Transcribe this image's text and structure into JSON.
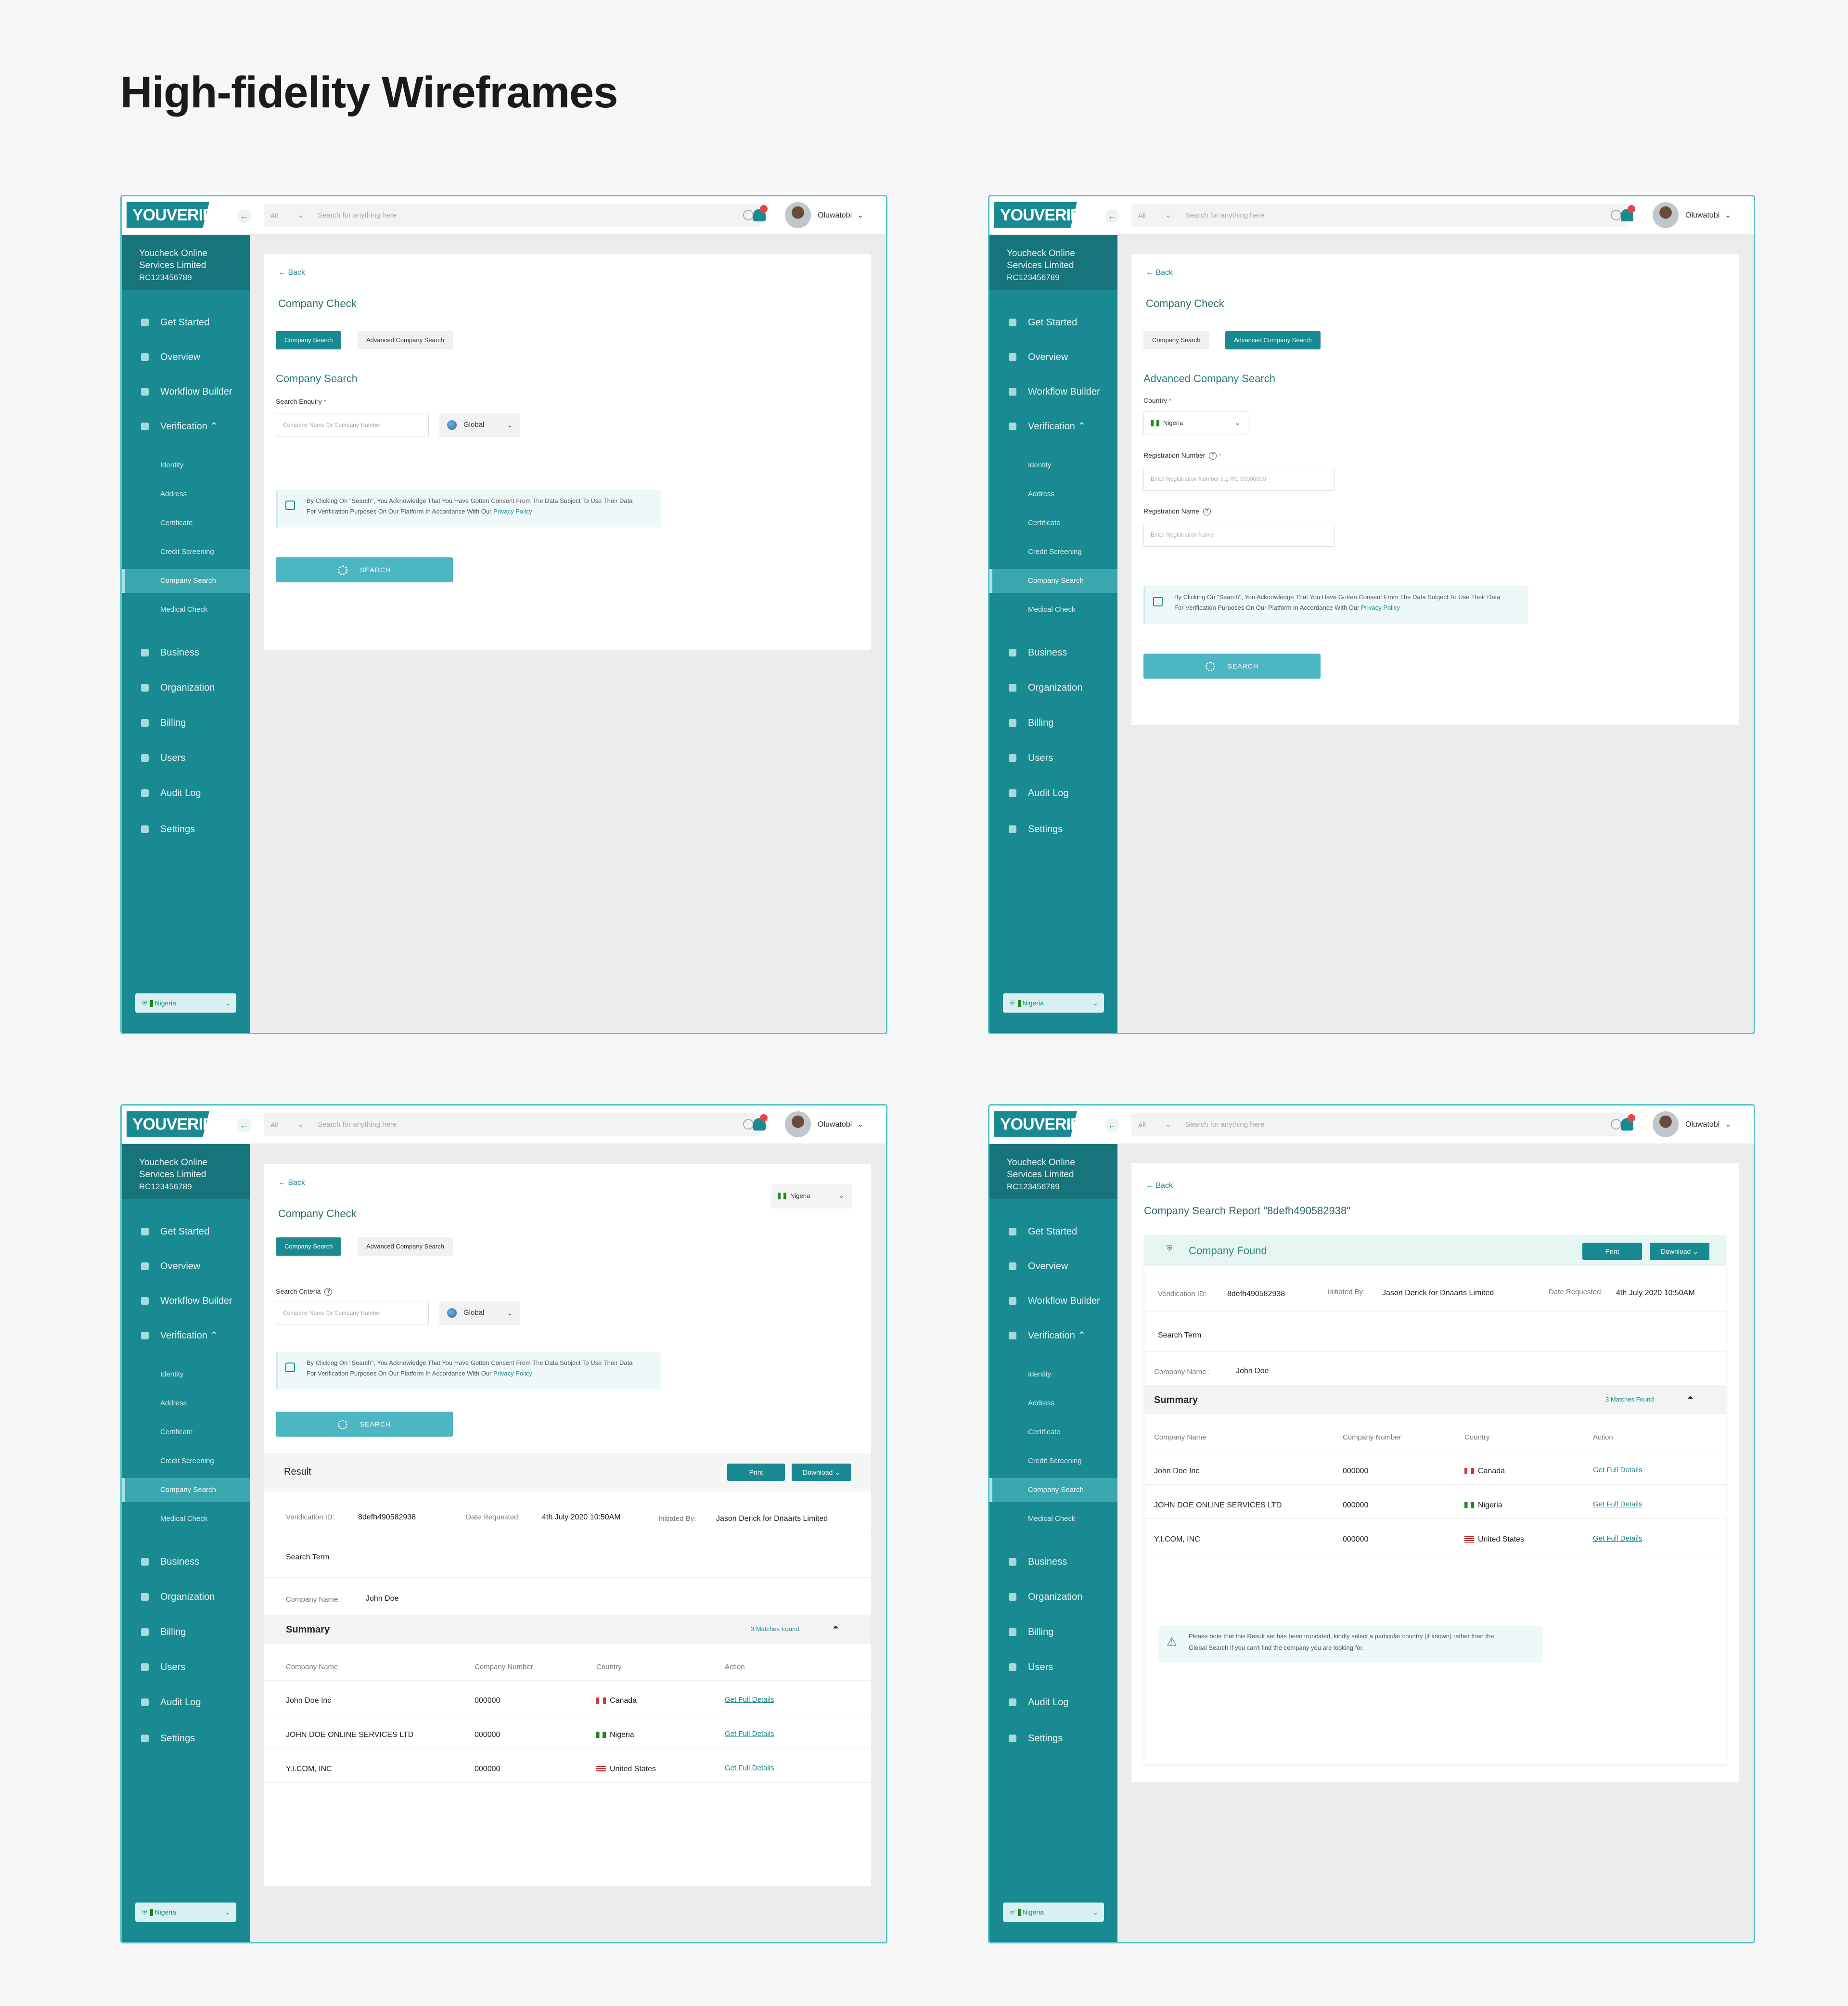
{
  "page_title": "High-fidelity Wireframes",
  "app": {
    "logo": "YOUVERIFY",
    "search_scope": "All",
    "search_placeholder": "Search for anything here",
    "user_name": "Oluwatobi",
    "org_name_line1": "Youcheck Online",
    "org_name_line2": "Services Limited",
    "org_rc": "RC123456789",
    "country_selector": "Nigeria"
  },
  "nav": {
    "get_started": "Get Started",
    "overview": "Overview",
    "workflow_builder": "Workflow Builder",
    "verification": "Verification",
    "identity": "Identity",
    "address": "Address",
    "certificate": "Certificate",
    "credit_screening": "Credit Screening",
    "company_search": "Company Search",
    "medical_check": "Medical Check",
    "business": "Business",
    "organization": "Organization",
    "billing": "Billing",
    "users": "Users",
    "audit_log": "Audit Log",
    "settings": "Settings"
  },
  "common": {
    "back": "Back",
    "company_check": "Company Check",
    "tab_company_search": "Company Search",
    "tab_advanced_company_search": "Advanced Company Search",
    "company_name_placeholder": "Company Name Or Company Number",
    "global": "Global",
    "consent_line1": "By Clicking On \"Search\", You Acknowledge That You Have Gotten Consent From The Data Subject To Use Their Data",
    "consent_line2": "For Verification Purposes On Our Platform In Accordance With Our",
    "privacy_policy": "Privacy Policy",
    "search_button": "SEARCH",
    "nigeria": "Nigeria"
  },
  "frame1": {
    "section_title": "Company Search",
    "field_label": "Search Enquiry"
  },
  "frame2": {
    "section_title": "Advanced Company Search",
    "country_label": "Country",
    "reg_number_label": "Registration Number",
    "reg_number_placeholder": "Enter Registration Number e.g RC 00000000",
    "reg_name_label": "Registration Name",
    "reg_name_placeholder": "Enter Registration Name"
  },
  "result": {
    "result_label": "Result",
    "print": "Print",
    "download": "Download",
    "verification_id_label": "Veridication ID:",
    "verification_id": "8defh490582938",
    "date_label": "Date Requested:",
    "date_value": "4th July 2020 10:50AM",
    "initiated_label": "Initiated By:",
    "initiated_name": "Jason Derick",
    "initiated_for": "for",
    "initiated_company": "Dnaarts Limited",
    "search_term": "Search Term",
    "company_name_label": "Company Name :",
    "company_name_value": "John Doe",
    "summary": "Summary",
    "matches": "3 Matches Found",
    "columns": [
      "Company Name",
      "Company Number",
      "Country",
      "Action"
    ],
    "rows": [
      {
        "name": "John Doe Inc",
        "number": "000000",
        "country": "Canada",
        "action": "Get Full Details"
      },
      {
        "name": "JOHN DOE ONLINE SERVICES LTD",
        "number": "000000",
        "country": "Nigeria",
        "action": "Get Full Details"
      },
      {
        "name": "Y.I.COM, INC",
        "number": "000000",
        "country": "United States",
        "action": "Get Full Details"
      }
    ],
    "search_criteria": "Search Criteria"
  },
  "frame4": {
    "report_title": "Company Search Report \"8defh490582938\"",
    "company_found": "Company Found",
    "warning_line1": "Please note that this Result set has been truncated, kindly select a particular country (if known) rather than the",
    "warning_line2": "Global Search if you can't find the company you are looking for."
  }
}
